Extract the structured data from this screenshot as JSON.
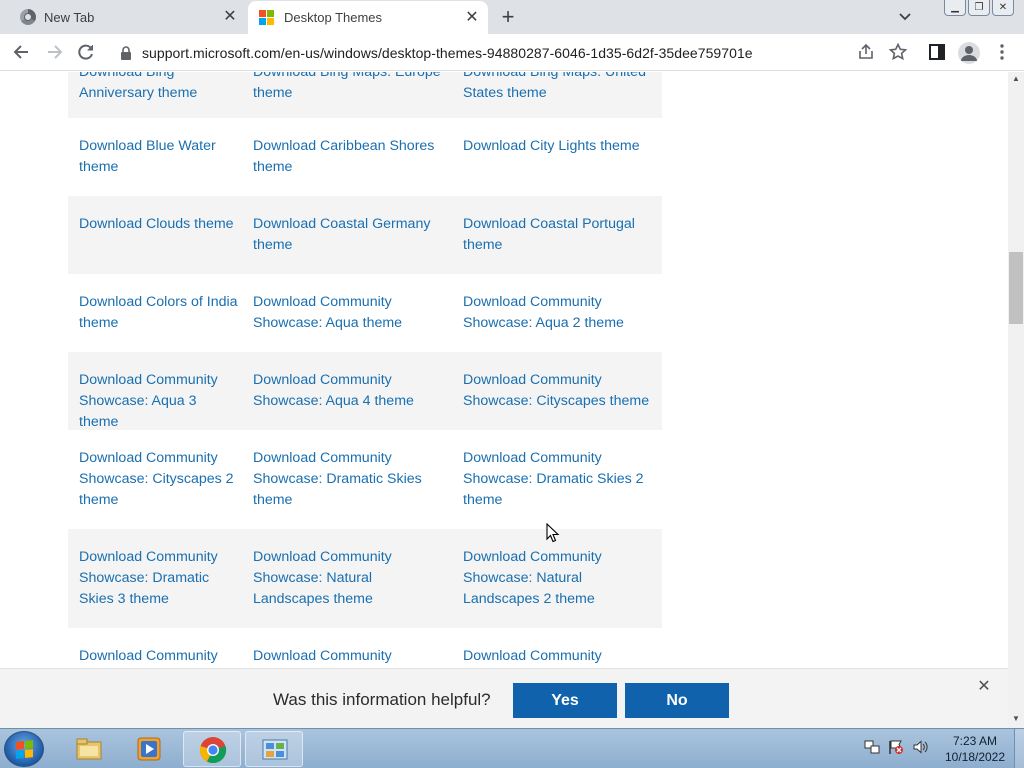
{
  "browser": {
    "tabs": [
      {
        "title": "New Tab",
        "favicon": "chrome-icon",
        "active": false
      },
      {
        "title": "Desktop Themes",
        "favicon": "microsoft-logo-icon",
        "active": true
      }
    ],
    "url": "support.microsoft.com/en-us/windows/desktop-themes-94880287-6046-1d35-6d2f-35dee759701e"
  },
  "themes": {
    "rows": [
      {
        "shaded": true,
        "cells": [
          "Download Bing Anniversary theme",
          "Download Bing Maps: Europe theme",
          "Download Bing Maps: United States theme"
        ]
      },
      {
        "shaded": false,
        "cells": [
          "Download Blue Water theme",
          "Download Caribbean Shores theme",
          "Download City Lights theme"
        ]
      },
      {
        "shaded": true,
        "cells": [
          "Download Clouds theme",
          "Download Coastal Germany theme",
          "Download Coastal Portugal theme"
        ]
      },
      {
        "shaded": false,
        "cells": [
          "Download Colors of India theme",
          "Download Community Showcase: Aqua theme",
          "Download Community Showcase: Aqua 2 theme"
        ]
      },
      {
        "shaded": true,
        "cells": [
          "Download Community Showcase: Aqua 3 theme",
          "Download Community Showcase: Aqua 4 theme",
          "Download Community Showcase: Cityscapes theme"
        ]
      },
      {
        "shaded": false,
        "cells": [
          "Download Community Showcase: Cityscapes 2 theme",
          "Download Community Showcase: Dramatic Skies theme",
          "Download Community Showcase: Dramatic Skies 2 theme"
        ]
      },
      {
        "shaded": true,
        "cells": [
          "Download Community Showcase: Dramatic Skies 3 theme",
          "Download Community Showcase: Natural Landscapes theme",
          "Download Community Showcase: Natural Landscapes 2 theme"
        ]
      },
      {
        "shaded": false,
        "cells": [
          "Download Community",
          "Download Community",
          "Download Community"
        ]
      }
    ]
  },
  "feedback": {
    "question": "Was this information helpful?",
    "yes_label": "Yes",
    "no_label": "No"
  },
  "taskbar": {
    "apps": [
      "windows-explorer-icon",
      "media-player-icon",
      "chrome-icon",
      "control-panel-icon"
    ],
    "time": "7:23 AM",
    "date": "10/18/2022"
  },
  "colors": {
    "link": "#1a6fb0",
    "button": "#0f62ab",
    "row_shade": "#f4f4f4"
  }
}
